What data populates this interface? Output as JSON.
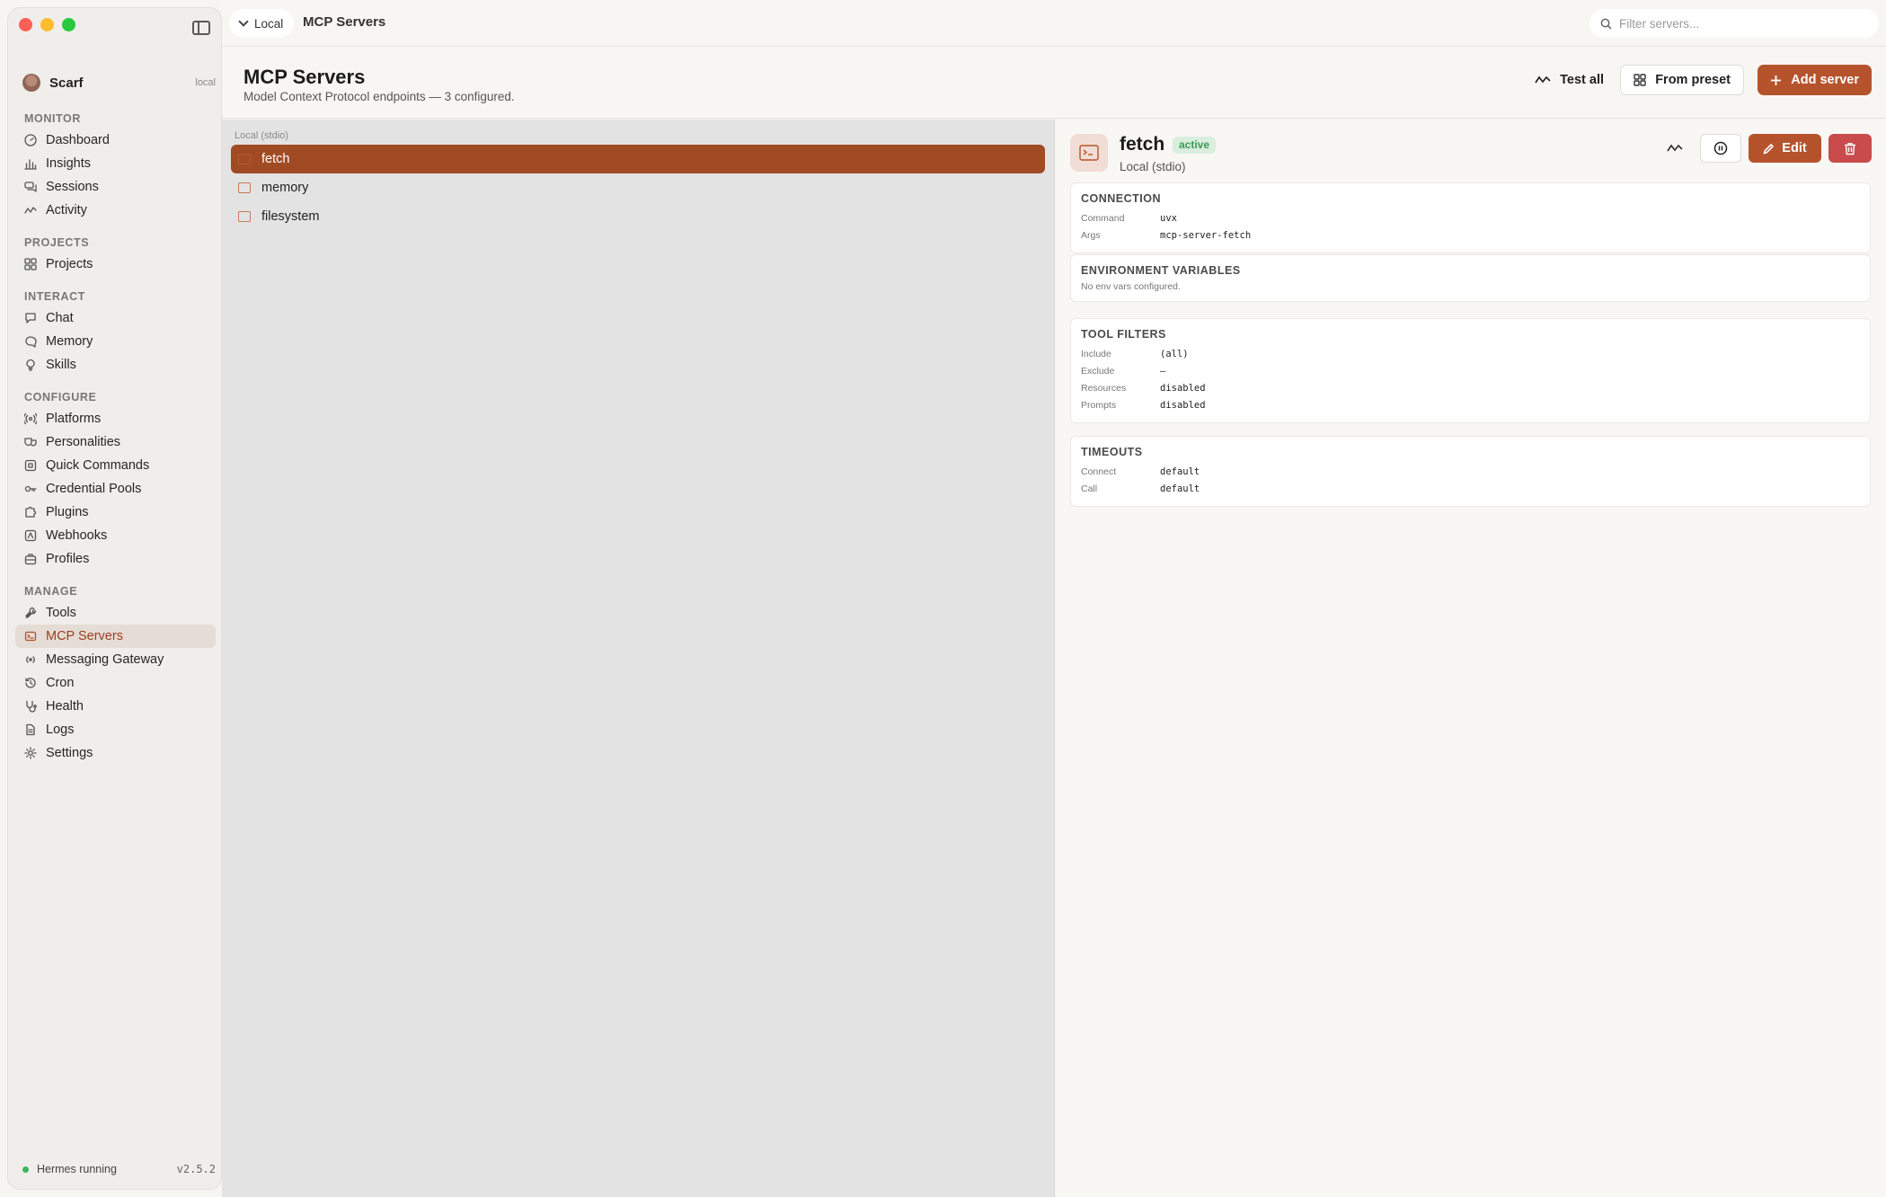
{
  "window": {
    "title": "MCP Servers"
  },
  "sidebar": {
    "profile": {
      "name": "Scarf",
      "tag": "local"
    },
    "sections": [
      {
        "title": "MONITOR",
        "items": [
          {
            "label": "Dashboard",
            "icon": "gauge-icon"
          },
          {
            "label": "Insights",
            "icon": "bar-chart-icon"
          },
          {
            "label": "Sessions",
            "icon": "chat-bubbles-icon"
          },
          {
            "label": "Activity",
            "icon": "activity-wave-icon"
          }
        ]
      },
      {
        "title": "PROJECTS",
        "items": [
          {
            "label": "Projects",
            "icon": "grid-icon"
          }
        ]
      },
      {
        "title": "INTERACT",
        "items": [
          {
            "label": "Chat",
            "icon": "chat-bubble-icon"
          },
          {
            "label": "Memory",
            "icon": "brain-icon"
          },
          {
            "label": "Skills",
            "icon": "lightbulb-icon"
          }
        ]
      },
      {
        "title": "CONFIGURE",
        "items": [
          {
            "label": "Platforms",
            "icon": "broadcast-icon"
          },
          {
            "label": "Personalities",
            "icon": "masks-icon"
          },
          {
            "label": "Quick Commands",
            "icon": "command-icon"
          },
          {
            "label": "Credential Pools",
            "icon": "key-icon"
          },
          {
            "label": "Plugins",
            "icon": "puzzle-icon"
          },
          {
            "label": "Webhooks",
            "icon": "webhook-icon"
          },
          {
            "label": "Profiles",
            "icon": "briefcase-icon"
          }
        ]
      },
      {
        "title": "MANAGE",
        "items": [
          {
            "label": "Tools",
            "icon": "wrench-icon"
          },
          {
            "label": "MCP Servers",
            "icon": "server-icon",
            "active": true
          },
          {
            "label": "Messaging Gateway",
            "icon": "antenna-icon"
          },
          {
            "label": "Cron",
            "icon": "clock-icon"
          },
          {
            "label": "Health",
            "icon": "stethoscope-icon"
          },
          {
            "label": "Logs",
            "icon": "document-icon"
          },
          {
            "label": "Settings",
            "icon": "gear-icon"
          }
        ]
      }
    ],
    "footer": {
      "status": "Hermes running",
      "version": "v2.5.2",
      "status_color": "#3cb55a"
    }
  },
  "topbar": {
    "server_selector": "Local",
    "title": "MCP Servers",
    "search_placeholder": "Filter servers..."
  },
  "header": {
    "title": "MCP Servers",
    "subtitle": "Model Context Protocol endpoints — 3 configured.",
    "test_all_label": "Test all",
    "from_preset_label": "From preset",
    "add_server_label": "Add server"
  },
  "list": {
    "group_label": "Local (stdio)",
    "servers": [
      {
        "name": "fetch",
        "selected": true
      },
      {
        "name": "memory"
      },
      {
        "name": "filesystem"
      }
    ]
  },
  "detail": {
    "name": "fetch",
    "status": "active",
    "transport": "Local (stdio)",
    "edit_label": "Edit",
    "connection": {
      "title": "CONNECTION",
      "rows": [
        {
          "k": "Command",
          "v": "uvx"
        },
        {
          "k": "Args",
          "v": "mcp-server-fetch"
        }
      ]
    },
    "env": {
      "title": "ENVIRONMENT VARIABLES",
      "note": "No env vars configured."
    },
    "tool_filters": {
      "title": "TOOL FILTERS",
      "rows": [
        {
          "k": "Include",
          "v": "(all)"
        },
        {
          "k": "Exclude",
          "v": "—"
        },
        {
          "k": "Resources",
          "v": "disabled"
        },
        {
          "k": "Prompts",
          "v": "disabled"
        }
      ]
    },
    "timeouts": {
      "title": "TIMEOUTS",
      "rows": [
        {
          "k": "Connect",
          "v": "default"
        },
        {
          "k": "Call",
          "v": "default"
        }
      ]
    }
  },
  "colors": {
    "accent": "#b5532d",
    "selected_row": "#a04b24",
    "danger": "#c94b4b",
    "active_badge": "#3a9a55"
  }
}
